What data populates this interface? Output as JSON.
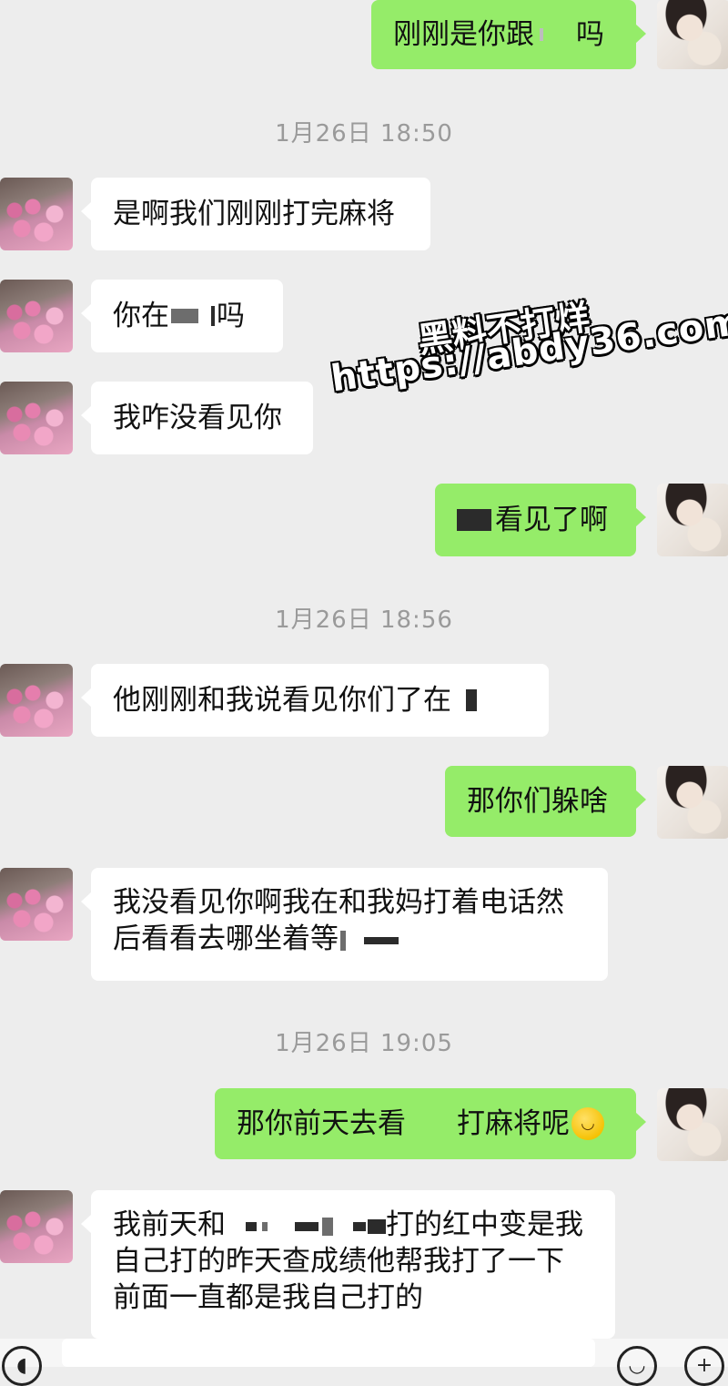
{
  "chat": {
    "timestamps": [
      "1月26日 18:50",
      "1月26日 18:56",
      "1月26日 19:05"
    ],
    "messages": {
      "m1": {
        "a": "刚刚是你跟",
        "b": "吗"
      },
      "m2": "是啊我们刚刚打完麻将",
      "m3": {
        "a": "你在",
        "b": "吗"
      },
      "m4": "我咋没看见你",
      "m5": "看见了啊",
      "m6": "他刚刚和我说看见你们了在",
      "m7": "那你们躲啥",
      "m8": {
        "line1": "我没看见你啊我在和我妈打着电话然",
        "line2": "后看看去哪坐着等"
      },
      "m9": {
        "a": "那你前天去看",
        "b": "打麻将呢"
      },
      "m10": {
        "line1a": "我前天和",
        "line1b": "打的红中变是我",
        "line2": "自己打的昨天查成绩他帮我打了一下",
        "line3": "前面一直都是我自己打的"
      }
    }
  },
  "watermark": {
    "line1": "黑料不打烊",
    "line2": "https://abdy36.com"
  },
  "input_bar": {
    "left_icon": "voice-icon",
    "emoji_icon": "emoji-icon",
    "plus_icon": "plus-icon"
  }
}
